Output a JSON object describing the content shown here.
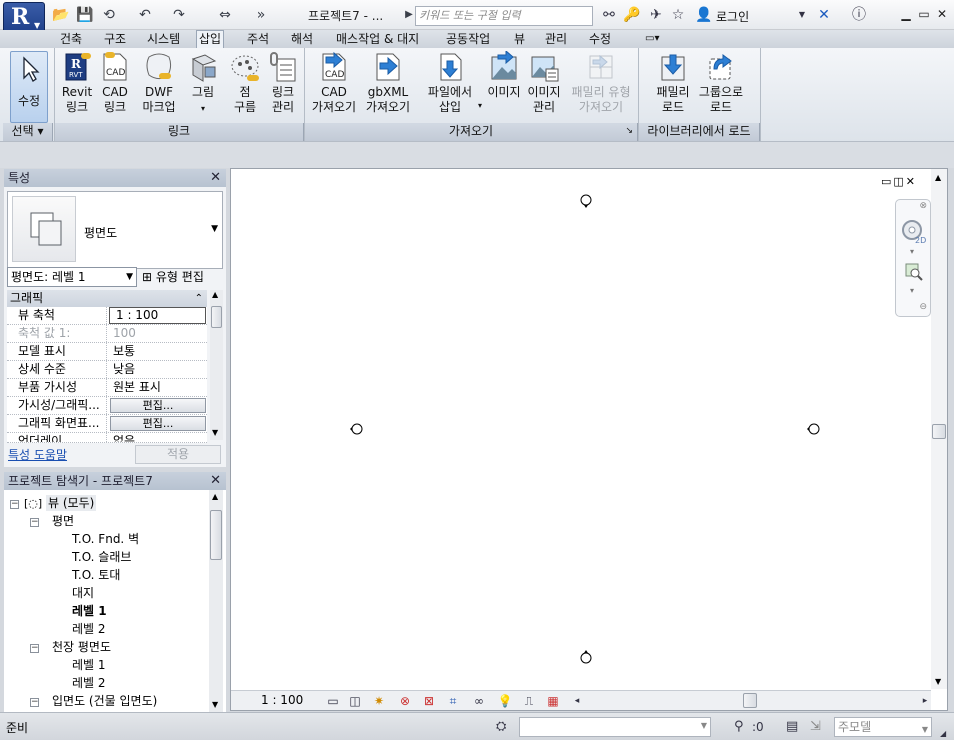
{
  "titlebar": {
    "app_letter": "R",
    "doc_title": "프로젝트7 - ...",
    "search_placeholder": "키워드 또는 구절 입력",
    "login": "로그인"
  },
  "tabs": [
    "건축",
    "구조",
    "시스템",
    "삽입",
    "주석",
    "해석",
    "매스작업 & 대지",
    "공동작업",
    "뷰",
    "관리",
    "수정"
  ],
  "active_tab": "삽입",
  "ribbon": {
    "select": {
      "label": "수정",
      "footer": "선택"
    },
    "link_panel": {
      "footer": "링크",
      "buttons": [
        {
          "l1": "Revit",
          "l2": "링크",
          "icon": "revit-link-icon"
        },
        {
          "l1": "CAD",
          "l2": "링크",
          "icon": "cad-link-icon"
        },
        {
          "l1": "DWF",
          "l2": "마크업",
          "icon": "dwf-markup-icon"
        },
        {
          "l1": "그림",
          "l2": "",
          "icon": "decal-icon"
        },
        {
          "l1": "점",
          "l2": "구름",
          "icon": "point-cloud-icon"
        },
        {
          "l1": "링크",
          "l2": "관리",
          "icon": "manage-links-icon"
        }
      ]
    },
    "import_panel": {
      "footer": "가져오기",
      "buttons": [
        {
          "l1": "CAD",
          "l2": "가져오기",
          "icon": "import-cad-icon",
          "disabled": false
        },
        {
          "l1": "gbXML",
          "l2": "가져오기",
          "icon": "import-gbxml-icon",
          "disabled": false
        },
        {
          "l1": "파일에서",
          "l2": "삽입",
          "icon": "insert-from-file-icon",
          "disabled": false
        },
        {
          "l1": "이미지",
          "l2": "",
          "icon": "image-icon",
          "disabled": false
        },
        {
          "l1": "이미지",
          "l2": "관리",
          "icon": "manage-images-icon",
          "disabled": false
        },
        {
          "l1": "패밀리 유형",
          "l2": "가져오기",
          "icon": "import-family-types-icon",
          "disabled": true
        }
      ]
    },
    "library_panel": {
      "footer": "라이브러리에서 로드",
      "buttons": [
        {
          "l1": "패밀리",
          "l2": "로드",
          "icon": "load-family-icon"
        },
        {
          "l1": "그룹으로",
          "l2": "로드",
          "icon": "load-as-group-icon"
        }
      ]
    }
  },
  "properties": {
    "title": "특성",
    "type_name": "평면도",
    "view_selector": "평면도: 레벨 1",
    "edit_type": "유형 편집",
    "group": "그래픽",
    "rows": [
      {
        "k": "뷰 축척",
        "v": "1 : 100"
      },
      {
        "k": "축척 값    1:",
        "v": "100"
      },
      {
        "k": "모델 표시",
        "v": "보통"
      },
      {
        "k": "상세 수준",
        "v": "낮음"
      },
      {
        "k": "부품 가시성",
        "v": "원본 표시"
      },
      {
        "k": "가시성/그래픽...",
        "v": "편집..."
      },
      {
        "k": "그래픽 화면표...",
        "v": "편집..."
      },
      {
        "k": "언더레이",
        "v": "없음"
      }
    ],
    "help": "특성 도움말",
    "apply": "적용"
  },
  "browser": {
    "title": "프로젝트 탐색기 - 프로젝트7",
    "items": [
      {
        "label": "뷰 (모두)",
        "bold": false
      },
      {
        "label": "평면",
        "bold": false
      },
      {
        "label": "T.O. Fnd. 벽",
        "bold": false
      },
      {
        "label": "T.O. 슬래브",
        "bold": false
      },
      {
        "label": "T.O. 토대",
        "bold": false
      },
      {
        "label": "대지",
        "bold": false
      },
      {
        "label": "레벨 1",
        "bold": true
      },
      {
        "label": "레벨 2",
        "bold": false
      },
      {
        "label": "천장 평면도",
        "bold": false
      },
      {
        "label": "레벨 1",
        "bold": false
      },
      {
        "label": "레벨 2",
        "bold": false
      },
      {
        "label": "입면도 (건물 입면도)",
        "bold": false
      }
    ]
  },
  "canvas": {
    "scale": "1 : 100"
  },
  "status": {
    "text": "준비",
    "click_count": ":0",
    "model": "주모델"
  },
  "colors": {
    "accent": "#1c3d86",
    "select_bg": "#b9d1ee",
    "link_blue": "#1a4fb1"
  }
}
